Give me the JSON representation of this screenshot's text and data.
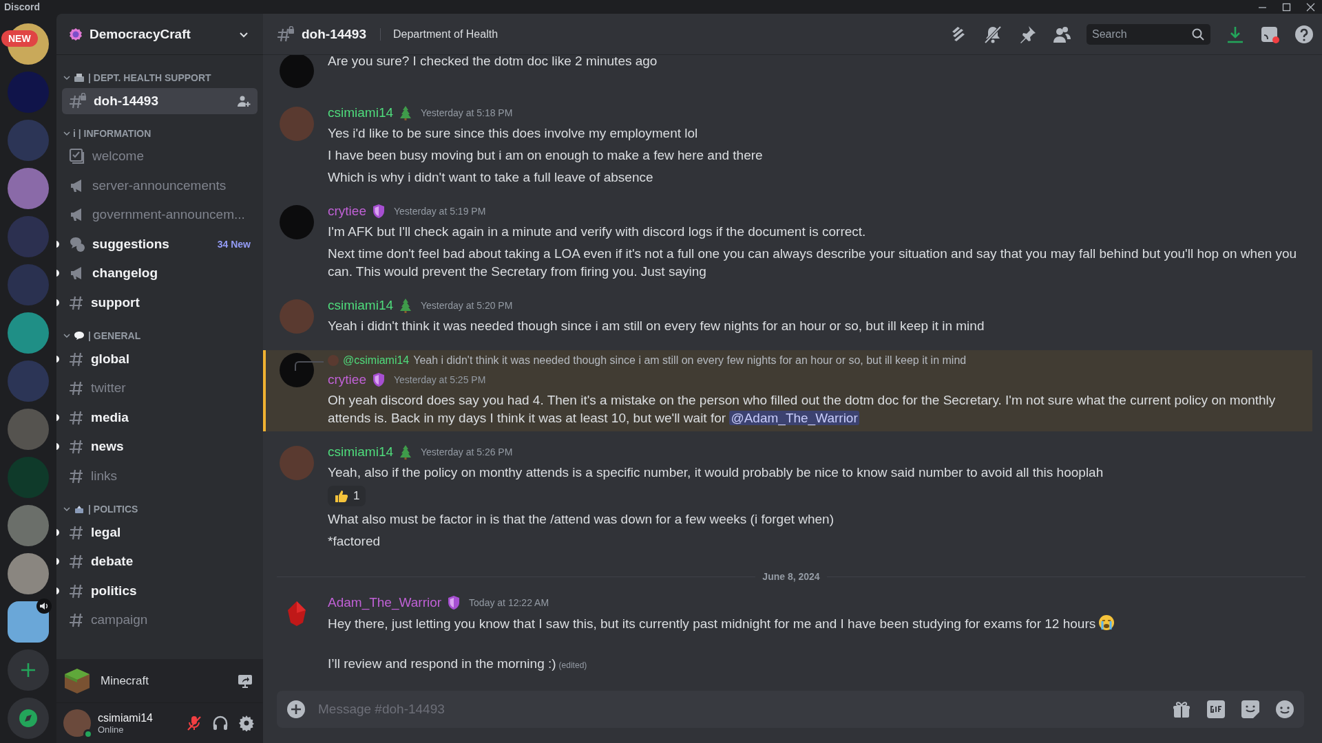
{
  "titlebar": {
    "app_name": "Discord"
  },
  "servers": {
    "new_badge": "NEW",
    "items": [
      {
        "color": "#c9a95a",
        "selected": false,
        "speaker": false
      },
      {
        "color": "#10144a",
        "selected": false,
        "speaker": false
      },
      {
        "color": "#2c3556",
        "selected": false,
        "speaker": false
      },
      {
        "color": "#8a6aa8",
        "selected": false,
        "speaker": false
      },
      {
        "color": "#2c3050",
        "selected": false,
        "speaker": false
      },
      {
        "color": "#2a3150",
        "selected": false,
        "speaker": false
      },
      {
        "color": "#1f8f86",
        "selected": false,
        "speaker": false
      },
      {
        "color": "#2c3556",
        "selected": false,
        "speaker": false
      },
      {
        "color": "#55534f",
        "selected": false,
        "speaker": false
      },
      {
        "color": "#0f3a2a",
        "selected": false,
        "speaker": false
      },
      {
        "color": "#6b6f6a",
        "selected": false,
        "speaker": false
      },
      {
        "color": "#8a8680",
        "selected": false,
        "speaker": false
      },
      {
        "color": "#6aa7d8",
        "selected": true,
        "speaker": true
      }
    ]
  },
  "sidebar": {
    "server_name": "DemocracyCraft",
    "categories": [
      {
        "name": "| DEPT. HEALTH SUPPORT",
        "expanded": true,
        "channels": [
          {
            "name": "doh-14493",
            "kind": "private",
            "unread": true,
            "selected": true
          }
        ]
      },
      {
        "name": "i | INFORMATION",
        "expanded": true,
        "channels": [
          {
            "name": "welcome",
            "kind": "rules",
            "unread": false,
            "selected": false
          },
          {
            "name": "server-announcements",
            "kind": "announcement",
            "unread": false,
            "selected": false
          },
          {
            "name": "government-announcem...",
            "kind": "announcement",
            "unread": false,
            "selected": false
          },
          {
            "name": "suggestions",
            "kind": "forum",
            "unread": true,
            "selected": false,
            "badge": "34 New"
          },
          {
            "name": "changelog",
            "kind": "announcement",
            "unread": true,
            "selected": false
          },
          {
            "name": "support",
            "kind": "text",
            "unread": true,
            "selected": false
          }
        ]
      },
      {
        "name": "| GENERAL",
        "expanded": true,
        "channels": [
          {
            "name": "global",
            "kind": "text",
            "unread": true,
            "selected": false
          },
          {
            "name": "twitter",
            "kind": "text",
            "unread": false,
            "selected": false
          },
          {
            "name": "media",
            "kind": "text",
            "unread": true,
            "selected": false
          },
          {
            "name": "news",
            "kind": "text",
            "unread": true,
            "selected": false
          },
          {
            "name": "links",
            "kind": "text",
            "unread": false,
            "selected": false
          }
        ]
      },
      {
        "name": "| POLITICS",
        "expanded": true,
        "channels": [
          {
            "name": "legal",
            "kind": "text",
            "unread": true,
            "selected": false
          },
          {
            "name": "debate",
            "kind": "text",
            "unread": true,
            "selected": false
          },
          {
            "name": "politics",
            "kind": "text",
            "unread": true,
            "selected": false
          },
          {
            "name": "campaign",
            "kind": "text",
            "unread": false,
            "selected": false
          }
        ]
      }
    ],
    "activity": {
      "name": "Minecraft"
    },
    "user": {
      "name": "csimiami14",
      "status": "Online",
      "muted": true
    }
  },
  "header": {
    "channel": "doh-14493",
    "topic": "Department of Health",
    "search_placeholder": "Search"
  },
  "messages": [
    {
      "kind": "message",
      "avatar": {
        "kind": "dark"
      },
      "mentioned": false,
      "lines": [
        {
          "text": "Are you sure? I checked the dotm doc like 2 minutes ago"
        }
      ]
    },
    {
      "kind": "message",
      "avatar": {
        "kind": "photo"
      },
      "author": "csimiami14",
      "color": "#4fdc7c",
      "badge": {
        "kind": "tree"
      },
      "time": "Yesterday at 5:18 PM",
      "mentioned": false,
      "lines": [
        {
          "text": "Yes i'd like to be sure since this does involve my employment lol"
        },
        {
          "text": "I have been busy moving but i am on enough to make a few here and there"
        },
        {
          "text": "Which is why i didn't want to take a full leave of absence"
        }
      ]
    },
    {
      "kind": "message",
      "avatar": {
        "kind": "dark"
      },
      "author": "crytiee",
      "color": "#c061d6",
      "badge": {
        "kind": "shield"
      },
      "time": "Yesterday at 5:19 PM",
      "mentioned": false,
      "lines": [
        {
          "text": "I'm AFK but I'll check again in a minute and verify with discord logs if the document is correct."
        },
        {
          "text": "Next time don't feel bad about taking a LOA even if it's not a full one you can always describe your situation and say that you may fall behind but you'll hop on when you can. This would prevent the Secretary from firing you. Just saying"
        }
      ]
    },
    {
      "kind": "message",
      "avatar": {
        "kind": "photo"
      },
      "author": "csimiami14",
      "color": "#4fdc7c",
      "badge": {
        "kind": "tree"
      },
      "time": "Yesterday at 5:20 PM",
      "mentioned": false,
      "lines": [
        {
          "text": "Yeah i didn't think it was needed though since i am still on every few nights for an hour or so, but ill keep it in mind"
        }
      ]
    },
    {
      "kind": "message",
      "avatar": {
        "kind": "dark"
      },
      "author": "crytiee",
      "color": "#c061d6",
      "badge": {
        "kind": "shield"
      },
      "time": "Yesterday at 5:25 PM",
      "mentioned": true,
      "reply": {
        "author": "@csimiami14",
        "text": "Yeah i didn't think it was needed though since i am still on every few nights for an hour or so, but ill keep it in mind"
      },
      "lines": [
        {
          "text": "Oh yeah discord does say you had 4. Then it's a mistake on the person who filled out the dotm doc for the Secretary. I'm not sure what the current policy on monthly attends is. Back in my days I think it was at least 10, but we'll wait for",
          "mention": "@Adam_The_Warrior"
        }
      ]
    },
    {
      "kind": "message",
      "avatar": {
        "kind": "photo"
      },
      "author": "csimiami14",
      "color": "#4fdc7c",
      "badge": {
        "kind": "tree"
      },
      "time": "Yesterday at 5:26 PM",
      "mentioned": false,
      "lines": [
        {
          "text": "Yeah, also if the policy on monthy attends is a specific number, it would probably be nice to know said number to avoid all this hooplah",
          "reaction": {
            "count": "1",
            "selected": false
          }
        },
        {
          "text": "What also must be factor in is that the /attend was down for a few weeks (i forget when)"
        },
        {
          "text": "*factored"
        }
      ]
    },
    {
      "kind": "divider",
      "text": "June 8, 2024"
    },
    {
      "kind": "message",
      "avatar": {
        "kind": "gem"
      },
      "author": "Adam_The_Warrior",
      "color": "#c061d6",
      "badge": {
        "kind": "shield"
      },
      "time": "Today at 12:22 AM",
      "mentioned": false,
      "lines": [
        {
          "text": "Hey there, just letting you know that I saw this, but its currently past midnight for me and I have been studying for exams for 12 hours",
          "emoji": {
            "kind": "crying"
          }
        },
        {
          "text": "\nI’ll review and respond in the morning :)",
          "edited": "(edited)"
        }
      ]
    }
  ],
  "composer": {
    "placeholder": "Message #doh-14493"
  }
}
